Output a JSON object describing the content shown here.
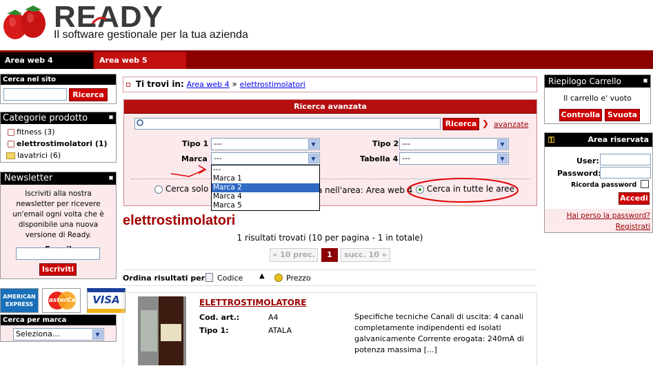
{
  "header": {
    "brand": "READY",
    "tagline": "Il software gestionale per la tua azienda"
  },
  "topnav": {
    "tabs": [
      "Area web 4",
      "Area web 5"
    ]
  },
  "left": {
    "search_title": "Cerca nel sito",
    "search_button": "Ricerca",
    "categories_title": "Categorie prodotto",
    "categories": [
      {
        "label": "fitness (3)",
        "bold": false
      },
      {
        "label": "elettrostimolatori (1)",
        "bold": true
      },
      {
        "label": "lavatrici (6)",
        "bold": false
      }
    ],
    "newsletter_title": "Newsletter",
    "newsletter_text": "Iscriviti alla nostra newsletter per ricevere un'email ogni volta che è disponibile una nuova versione di Ready.",
    "email_label": "E-mail",
    "subscribe_button": "Iscriviti",
    "cards": [
      "AMERICAN EXPRESS",
      "MasterCard",
      "VISA"
    ],
    "brand_title": "Cerca per marca",
    "brand_select": "Seleziona..."
  },
  "breadcrumb": {
    "prefix": "Ti trovi in:",
    "item1": "Area web 4",
    "sep": "»",
    "item2": "elettrostimolatori"
  },
  "advanced": {
    "title": "Ricerca avanzata",
    "search_button": "Ricerca",
    "advanced_link": "avanzate",
    "tipo1_label": "Tipo 1",
    "tipo1_value": "---",
    "tipo2_label": "Tipo 2",
    "tipo2_value": "---",
    "marca_label": "Marca",
    "marca_value": "---",
    "tabella4_label": "Tabella 4",
    "tabella4_value": "---",
    "dropdown_options": [
      "---",
      "Marca 1",
      "Marca 2",
      "Marca 4",
      "Marca 5"
    ],
    "dropdown_selected_index": 2,
    "radio1": "Cerca solo i",
    "radio2": "a nell'area: Area web 4",
    "radio3": "Cerca in tutte le aree"
  },
  "results": {
    "heading": "elettrostimolatori",
    "count": "1 risultati trovati (10 per pagina - 1 in totale)",
    "prev": "« 10 prec.",
    "page": "1",
    "next": "succ. 10 »",
    "sort_label": "Ordina risultati per:",
    "sort_codice": "Codice",
    "sort_prezzo": "Prezzo",
    "product": {
      "name": "ELETTROSTIMOLATORE",
      "code_label": "Cod. art.:",
      "code": "A4",
      "type_label": "Tipo 1:",
      "type": "ATALA",
      "description": "Specifiche tecniche Canali di uscita: 4 canali completamente indipendenti ed isolati galvanicamente Corrente erogata: 240mA di potenza massima [...]"
    }
  },
  "right": {
    "cart_title": "Riepilogo Carrello",
    "cart_empty": "Il carrello e' vuoto",
    "cart_check": "Controlla",
    "cart_empty_btn": "Svuota",
    "area_title": "Area riservata",
    "user_label": "User:",
    "password_label": "Password:",
    "remember_label": "Ricorda password",
    "login_button": "Accedi",
    "forgot_link": "Hai perso la password?",
    "register_link": "Registrati"
  },
  "colors": {
    "brand_red": "#c41010",
    "dark_red": "#8b0000",
    "pink_bg": "#fbe9ec",
    "annotation_red": "#e00000"
  }
}
